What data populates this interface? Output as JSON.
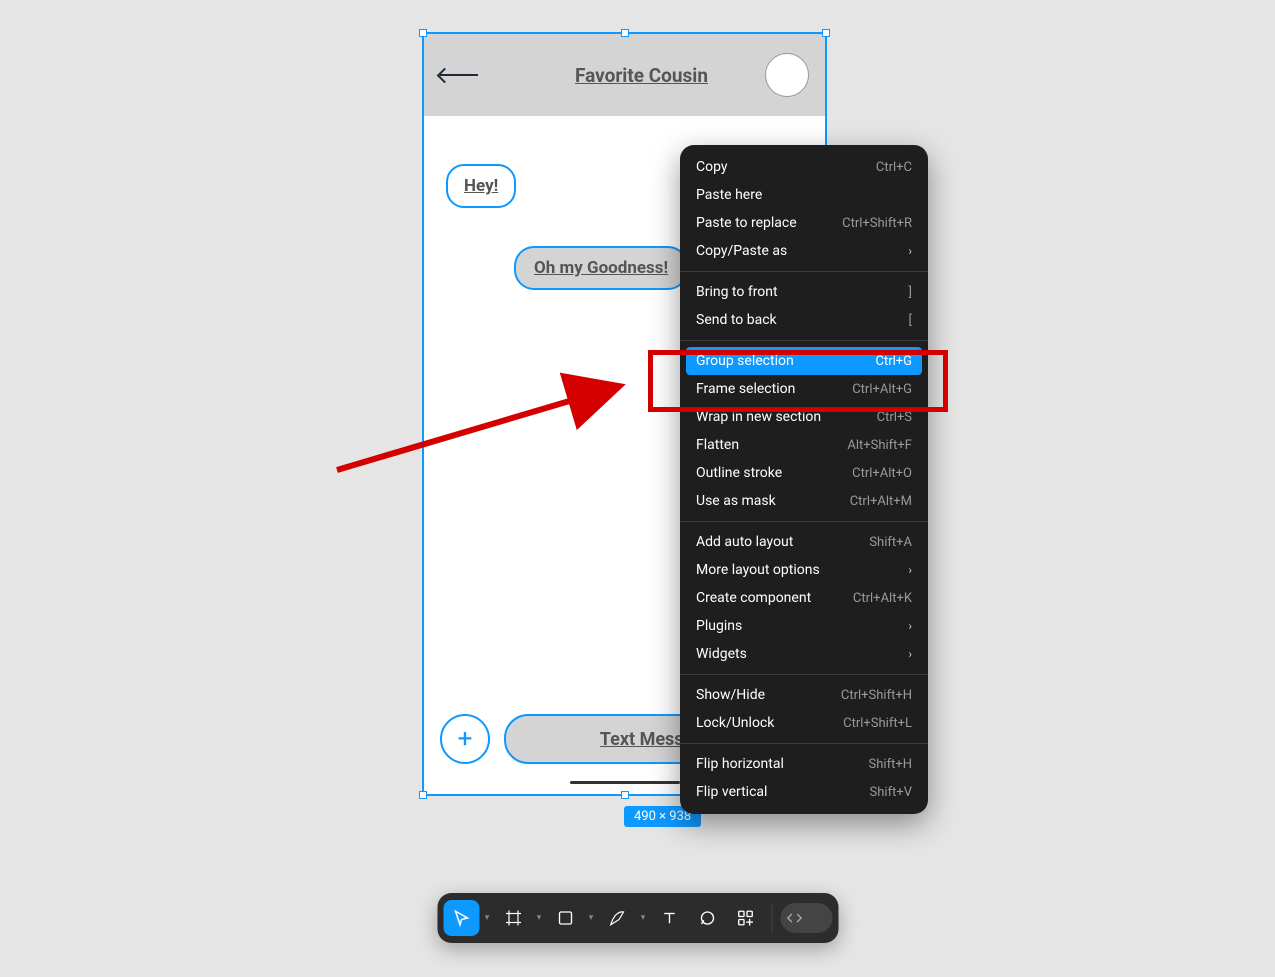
{
  "frame": {
    "header_title": "Favorite Cousin",
    "bubble_left": "Hey!",
    "bubble_right": "Oh my Goodness!",
    "compose_placeholder": "Text Message",
    "dimensions_badge": "490 × 938"
  },
  "context_menu": {
    "items": [
      {
        "label": "Copy",
        "shortcut": "Ctrl+C"
      },
      {
        "label": "Paste here",
        "shortcut": ""
      },
      {
        "label": "Paste to replace",
        "shortcut": "Ctrl+Shift+R"
      },
      {
        "label": "Copy/Paste as",
        "shortcut": "",
        "submenu": true
      },
      {
        "separator": true
      },
      {
        "label": "Bring to front",
        "shortcut": "]"
      },
      {
        "label": "Send to back",
        "shortcut": "["
      },
      {
        "separator": true
      },
      {
        "label": "Group selection",
        "shortcut": "Ctrl+G",
        "highlighted": true
      },
      {
        "label": "Frame selection",
        "shortcut": "Ctrl+Alt+G"
      },
      {
        "label": "Wrap in new section",
        "shortcut": "Ctrl+S"
      },
      {
        "label": "Flatten",
        "shortcut": "Alt+Shift+F"
      },
      {
        "label": "Outline stroke",
        "shortcut": "Ctrl+Alt+O"
      },
      {
        "label": "Use as mask",
        "shortcut": "Ctrl+Alt+M"
      },
      {
        "separator": true
      },
      {
        "label": "Add auto layout",
        "shortcut": "Shift+A"
      },
      {
        "label": "More layout options",
        "shortcut": "",
        "submenu": true
      },
      {
        "label": "Create component",
        "shortcut": "Ctrl+Alt+K"
      },
      {
        "label": "Plugins",
        "shortcut": "",
        "submenu": true
      },
      {
        "label": "Widgets",
        "shortcut": "",
        "submenu": true
      },
      {
        "separator": true
      },
      {
        "label": "Show/Hide",
        "shortcut": "Ctrl+Shift+H"
      },
      {
        "label": "Lock/Unlock",
        "shortcut": "Ctrl+Shift+L"
      },
      {
        "separator": true
      },
      {
        "label": "Flip horizontal",
        "shortcut": "Shift+H"
      },
      {
        "label": "Flip vertical",
        "shortcut": "Shift+V"
      }
    ]
  },
  "toolbar": {
    "tools": [
      "move",
      "frame",
      "shape",
      "pen",
      "text",
      "comment",
      "actions"
    ]
  }
}
